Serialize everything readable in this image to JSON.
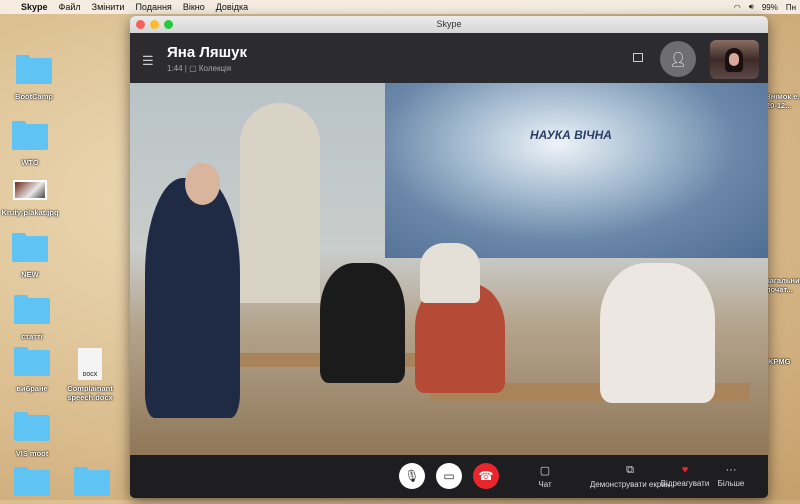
{
  "menubar": {
    "app": "Skype",
    "items": [
      "Файл",
      "Змінити",
      "Подання",
      "Вікно",
      "Довідка"
    ],
    "battery": "99%",
    "clock": "Пн"
  },
  "desktop": {
    "icons": [
      "BootCamp",
      "WTO",
      "Kruty-plakat.jpg",
      "NEW",
      "статтi",
      "вибране",
      "Complainant speech.docx",
      "VIS moot"
    ],
    "doc_badge": "DOCX",
    "right_icons": [
      "Знімок е... 20-12...",
      "загальни... почат...",
      "KPMG"
    ]
  },
  "window": {
    "title": "Skype"
  },
  "call": {
    "name": "Яна Ляшук",
    "duration": "1:44",
    "group": "Колекція",
    "mural_text": "НАУКА ВІЧНА"
  },
  "controls": {
    "chat": "Чат",
    "share": "Демонструвати екран",
    "react": "Відреагувати",
    "more": "Більше"
  },
  "colors": {
    "end_call": "#e8262b",
    "heart": "#e8262b",
    "folder": "#5fc4f4"
  }
}
